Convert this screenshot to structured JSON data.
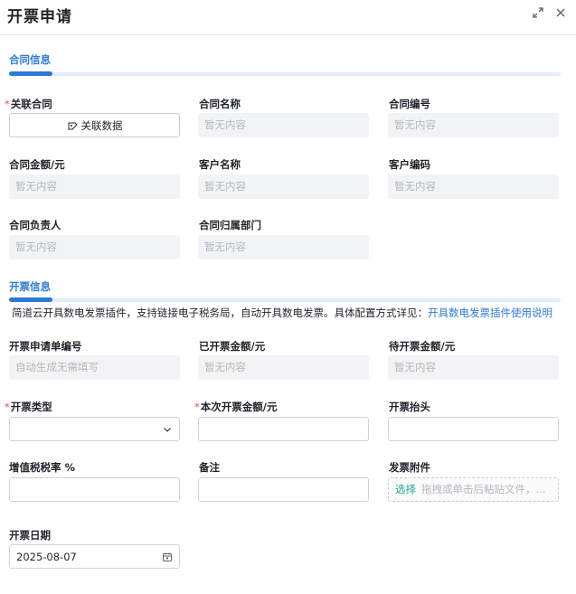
{
  "header": {
    "title": "开票申请"
  },
  "contract_section": {
    "title": "合同信息",
    "related_contract": {
      "label": "关联合同",
      "button": "关联数据"
    },
    "contract_name": {
      "label": "合同名称",
      "value": "暂无内容"
    },
    "contract_no": {
      "label": "合同编号",
      "value": "暂无内容"
    },
    "contract_amount": {
      "label": "合同金额/元",
      "value": "暂无内容"
    },
    "customer_name": {
      "label": "客户名称",
      "value": "暂无内容"
    },
    "customer_code": {
      "label": "客户编码",
      "value": "暂无内容"
    },
    "contract_owner": {
      "label": "合同负责人",
      "value": "暂无内容"
    },
    "contract_dept": {
      "label": "合同归属部门",
      "value": "暂无内容"
    }
  },
  "invoice_section": {
    "title": "开票信息",
    "notice_text": "简道云开具数电发票插件，支持链接电子税务局，自动开具数电发票。具体配置方式详见：",
    "notice_link": "开具数电发票插件使用说明",
    "apply_no": {
      "label": "开票申请单编号",
      "value": "自动生成无需填写"
    },
    "invoiced_amount": {
      "label": "已开票金额/元",
      "value": "暂无内容"
    },
    "pending_amount": {
      "label": "待开票金额/元",
      "value": "暂无内容"
    },
    "invoice_type": {
      "label": "开票类型",
      "value": ""
    },
    "current_amount": {
      "label": "本次开票金额/元",
      "value": ""
    },
    "invoice_header": {
      "label": "开票抬头",
      "value": ""
    },
    "vat_rate": {
      "label": "增值税税率 %",
      "value": ""
    },
    "remark": {
      "label": "备注",
      "value": ""
    },
    "attachment": {
      "label": "发票附件",
      "pick": "选择",
      "hint": "拖拽或单击后粘贴文件，..."
    },
    "invoice_date": {
      "label": "开票日期",
      "value": "2025-08-07"
    }
  },
  "icons": [
    "expand-icon",
    "close-icon",
    "link-data-icon",
    "chevron-down-icon",
    "calendar-icon"
  ],
  "colors": {
    "accent": "#2d7bd6",
    "required": "#f5483b",
    "upload_pick": "#1aae8a"
  }
}
